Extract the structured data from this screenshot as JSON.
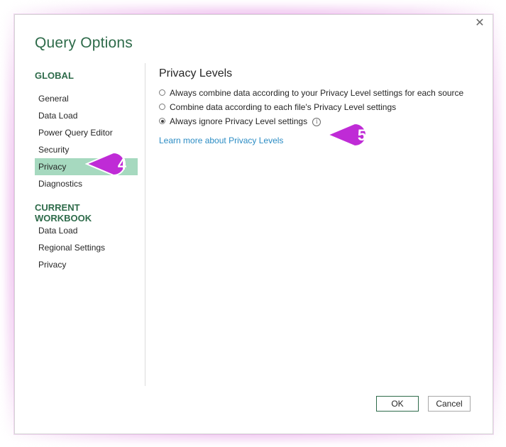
{
  "dialog": {
    "title": "Query Options",
    "close_glyph": "✕"
  },
  "nav": {
    "global_heading": "GLOBAL",
    "global_items": [
      {
        "label": "General"
      },
      {
        "label": "Data Load"
      },
      {
        "label": "Power Query Editor"
      },
      {
        "label": "Security"
      },
      {
        "label": "Privacy",
        "selected": true
      },
      {
        "label": "Diagnostics"
      }
    ],
    "workbook_heading": "CURRENT WORKBOOK",
    "workbook_items": [
      {
        "label": "Data Load"
      },
      {
        "label": "Regional Settings"
      },
      {
        "label": "Privacy"
      }
    ]
  },
  "content": {
    "section_title": "Privacy Levels",
    "options": [
      {
        "label": "Always combine data according to your Privacy Level settings for each source",
        "checked": false
      },
      {
        "label": "Combine data according to each file's Privacy Level settings",
        "checked": false
      },
      {
        "label": "Always ignore Privacy Level settings",
        "checked": true
      }
    ],
    "info_glyph": "i",
    "learn_more_link": "Learn more about Privacy Levels"
  },
  "buttons": {
    "ok_label": "OK",
    "cancel_label": "Cancel"
  },
  "annotations": {
    "callout_4": "4",
    "callout_5": "5",
    "callout_color": "#bf2bd6"
  }
}
